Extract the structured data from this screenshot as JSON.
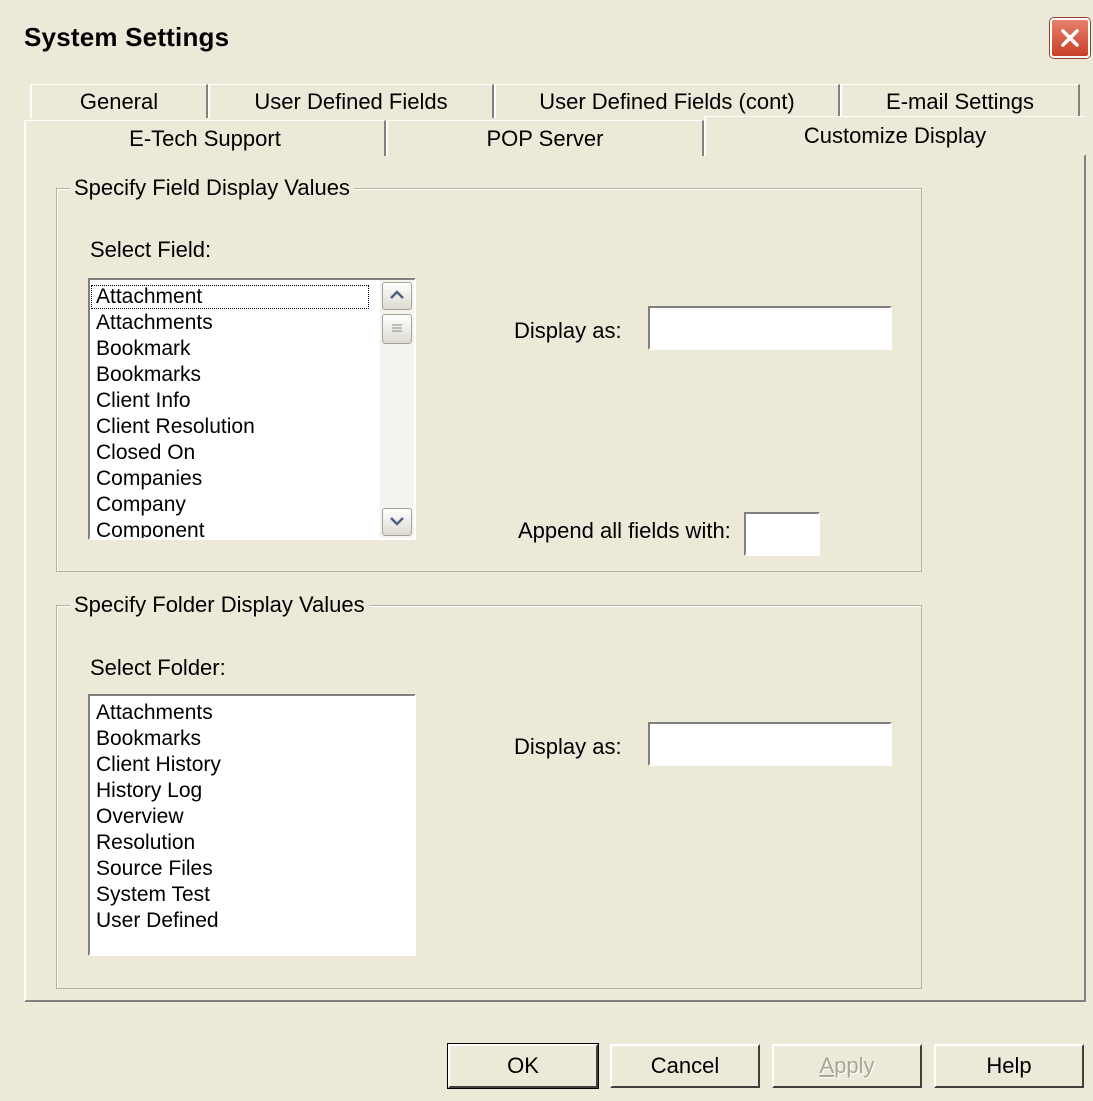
{
  "window": {
    "title": "System Settings",
    "close_icon": "close-icon",
    "accent_close": "#c7402a"
  },
  "tabs_back_row": [
    {
      "label": "General"
    },
    {
      "label": "User Defined Fields"
    },
    {
      "label": "User Defined Fields (cont)"
    },
    {
      "label": "E-mail Settings"
    }
  ],
  "tabs_front_row": [
    {
      "label": "E-Tech Support"
    },
    {
      "label": "POP Server"
    },
    {
      "label": "Customize Display",
      "active": true
    }
  ],
  "field_group": {
    "legend": "Specify Field Display Values",
    "select_label": "Select Field:",
    "items": [
      "Attachment",
      "Attachments",
      "Bookmark",
      "Bookmarks",
      "Client Info",
      "Client Resolution",
      "Closed On",
      "Companies",
      "Company",
      "Component"
    ],
    "selected_index": 0,
    "display_as_label": "Display as:",
    "display_as_value": "",
    "append_label": "Append all fields with:",
    "append_value": ""
  },
  "folder_group": {
    "legend": "Specify Folder Display Values",
    "select_label": "Select Folder:",
    "items": [
      "Attachments",
      "Bookmarks",
      "Client History",
      "History Log",
      "Overview",
      "Resolution",
      "Source Files",
      "System Test",
      "User Defined"
    ],
    "display_as_label": "Display as:",
    "display_as_value": ""
  },
  "buttons": {
    "ok": "OK",
    "cancel": "Cancel",
    "apply_first": "A",
    "apply_rest": "pply",
    "help": "Help"
  }
}
